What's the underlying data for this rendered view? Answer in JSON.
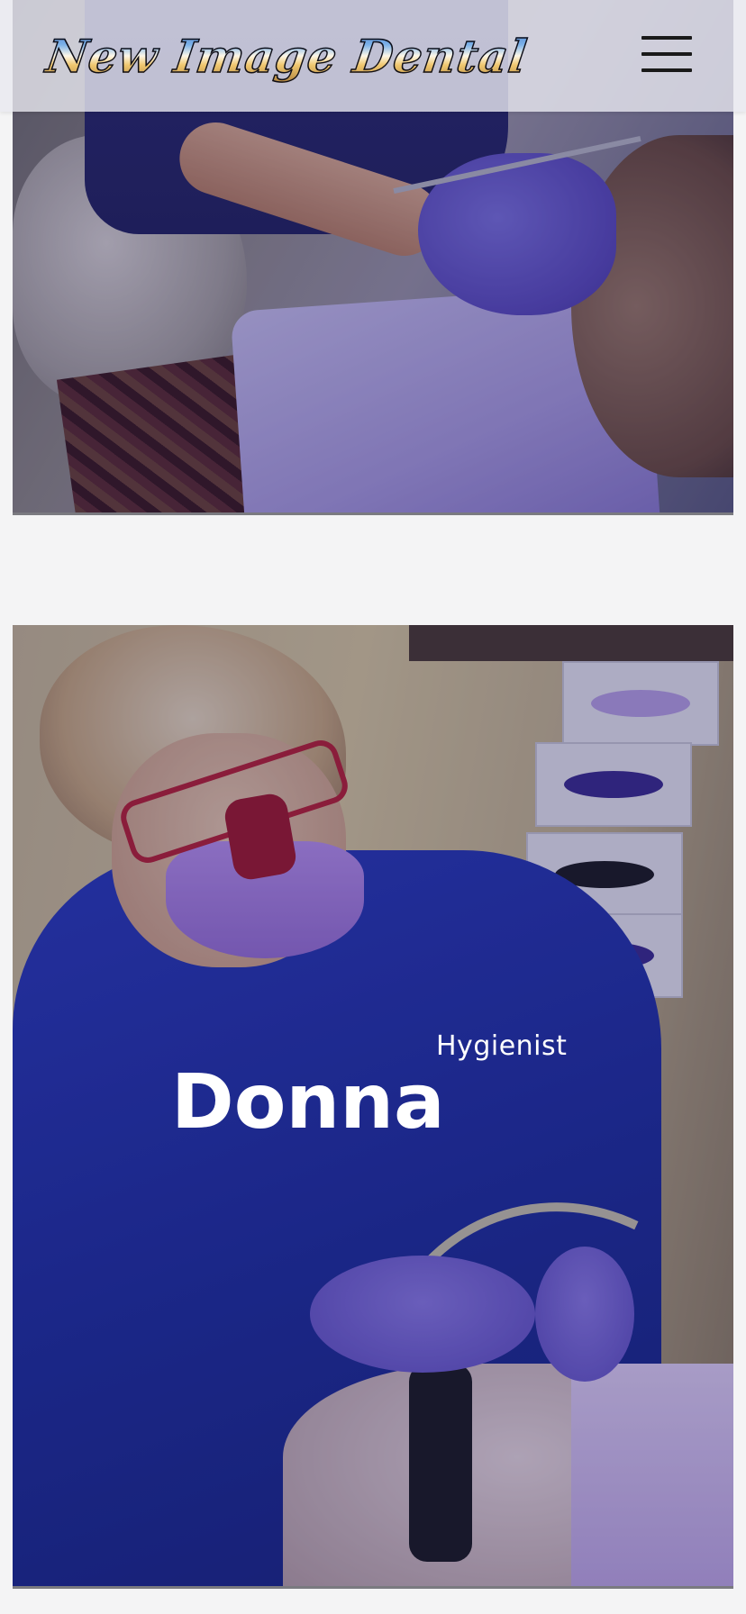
{
  "header": {
    "logo_text": "New Image Dental",
    "menu_icon": "hamburger-menu-icon"
  },
  "staff": [
    {
      "name": "",
      "role": "",
      "photo": "dental-hygienist-treating-patient-photo"
    },
    {
      "name": "Donna",
      "role": "Hygienist",
      "photo": "hygienist-donna-with-loupes-photo"
    }
  ],
  "colors": {
    "header_background": "#e8e8f0",
    "page_background": "#f4f4f5",
    "overlay": "#14145a",
    "text_on_photo": "#ffffff"
  }
}
